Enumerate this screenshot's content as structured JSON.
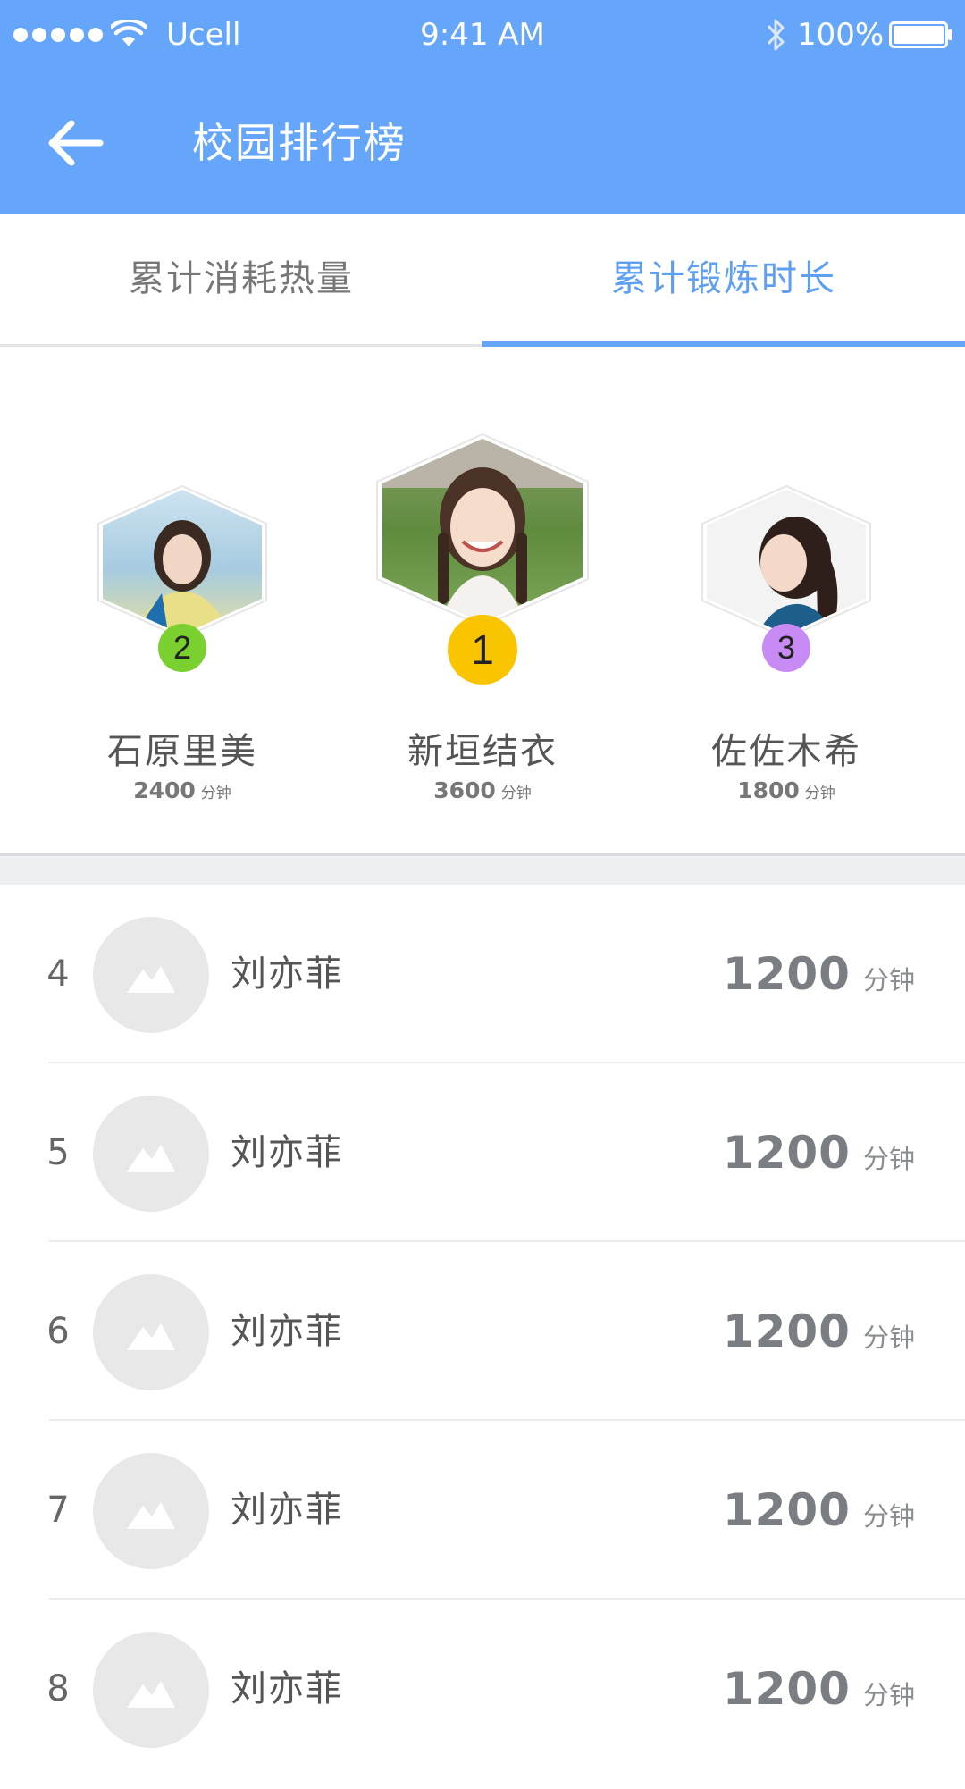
{
  "status_bar": {
    "carrier": "Ucell",
    "time": "9:41 AM",
    "battery": "100%",
    "icons": [
      "signal-dots",
      "wifi-icon",
      "bluetooth-icon",
      "battery-icon"
    ]
  },
  "nav": {
    "title": "校园排行榜",
    "back_icon": "arrow-left-icon"
  },
  "tabs": [
    {
      "label": "累计消耗热量",
      "active": false
    },
    {
      "label": "累计锻炼时长",
      "active": true
    }
  ],
  "podium": [
    {
      "rank": "2",
      "name": "石原里美",
      "score": "2400",
      "unit": "分钟",
      "badge_color": "#7ad02e"
    },
    {
      "rank": "1",
      "name": "新垣结衣",
      "score": "3600",
      "unit": "分钟",
      "badge_color": "#f9c400"
    },
    {
      "rank": "3",
      "name": "佐佐木希",
      "score": "1800",
      "unit": "分钟",
      "badge_color": "#c88bf5"
    }
  ],
  "list": [
    {
      "rank": "4",
      "name": "刘亦菲",
      "score": "1200",
      "unit": "分钟"
    },
    {
      "rank": "5",
      "name": "刘亦菲",
      "score": "1200",
      "unit": "分钟"
    },
    {
      "rank": "6",
      "name": "刘亦菲",
      "score": "1200",
      "unit": "分钟"
    },
    {
      "rank": "7",
      "name": "刘亦菲",
      "score": "1200",
      "unit": "分钟"
    },
    {
      "rank": "8",
      "name": "刘亦菲",
      "score": "1200",
      "unit": "分钟"
    }
  ],
  "colors": {
    "primary": "#66a6fa",
    "active_tab_text": "#5f9ff2",
    "placeholder_avatar": "#e8e8e8"
  }
}
